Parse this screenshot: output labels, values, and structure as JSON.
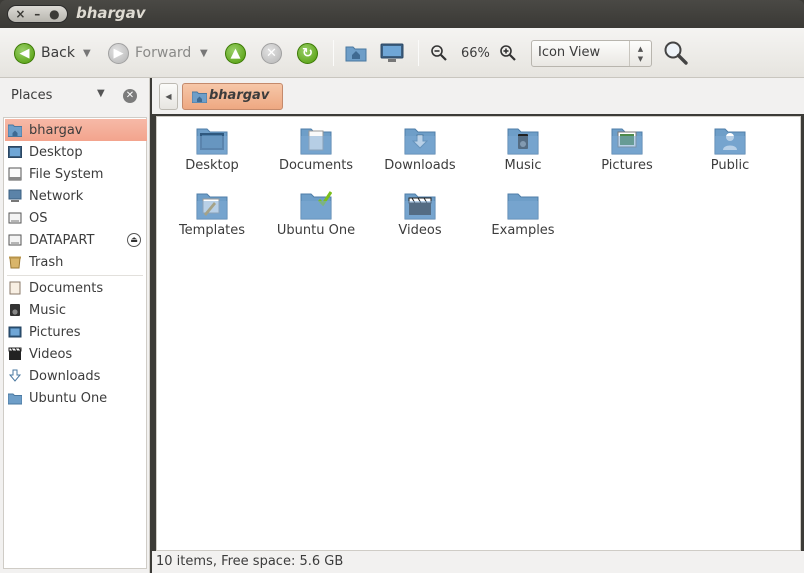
{
  "window": {
    "title": "bhargav",
    "controls": {
      "close": "×",
      "minimize": "–",
      "maximize": "●"
    }
  },
  "toolbar": {
    "back_label": "Back",
    "forward_label": "Forward",
    "zoom_level": "66%",
    "view_mode": "Icon View"
  },
  "sidebar": {
    "header": "Places",
    "items": [
      {
        "label": "bhargav",
        "icon": "home-folder-icon",
        "selected": true
      },
      {
        "label": "Desktop",
        "icon": "desktop-icon"
      },
      {
        "label": "File System",
        "icon": "filesystem-icon"
      },
      {
        "label": "Network",
        "icon": "network-icon"
      },
      {
        "label": "OS",
        "icon": "drive-icon"
      },
      {
        "label": "DATAPART",
        "icon": "drive-icon",
        "ejectable": true
      },
      {
        "label": "Trash",
        "icon": "trash-icon"
      },
      {
        "label": "Documents",
        "icon": "documents-icon"
      },
      {
        "label": "Music",
        "icon": "music-icon"
      },
      {
        "label": "Pictures",
        "icon": "pictures-icon"
      },
      {
        "label": "Videos",
        "icon": "videos-icon"
      },
      {
        "label": "Downloads",
        "icon": "downloads-icon"
      },
      {
        "label": "Ubuntu One",
        "icon": "ubuntu-one-icon"
      }
    ]
  },
  "location": {
    "current": "bhargav"
  },
  "files": [
    {
      "label": "Desktop",
      "icon": "desktop-folder-icon"
    },
    {
      "label": "Documents",
      "icon": "documents-folder-icon"
    },
    {
      "label": "Downloads",
      "icon": "downloads-folder-icon"
    },
    {
      "label": "Music",
      "icon": "music-folder-icon"
    },
    {
      "label": "Pictures",
      "icon": "pictures-folder-icon"
    },
    {
      "label": "Public",
      "icon": "public-folder-icon"
    },
    {
      "label": "Templates",
      "icon": "templates-folder-icon"
    },
    {
      "label": "Ubuntu One",
      "icon": "ubuntu-one-folder-icon"
    },
    {
      "label": "Videos",
      "icon": "videos-folder-icon"
    },
    {
      "label": "Examples",
      "icon": "examples-folder-icon"
    }
  ],
  "status": {
    "text": "10 items, Free space: 5.6 GB"
  },
  "colors": {
    "selection": "#f3a48d",
    "folder": "#6e9ec8",
    "titlebar": "#3c3b37"
  }
}
